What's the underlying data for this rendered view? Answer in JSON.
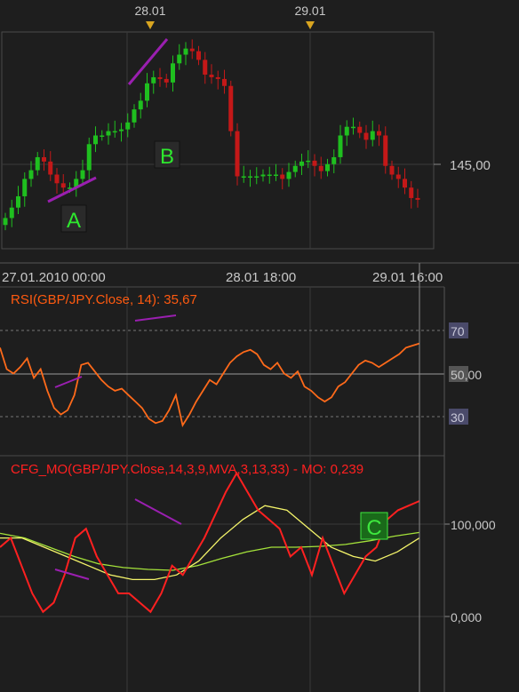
{
  "colors": {
    "background": "#1e1e1e",
    "grid": "#3a3a3a",
    "bull": "#1fbf1f",
    "bear": "#c41818",
    "rsi": "#ff6a1a",
    "mo": "#ff2020",
    "signal_yellow": "#f4f46a",
    "signal_green": "#a4e23a",
    "trendline": "#9a1fb0",
    "label_text": "#c8c8c8",
    "rsi_title": "#ff5a10",
    "mo_title": "#ff2020",
    "axis_tag_bg": "#4a4a6a",
    "marker": "#d9a520"
  },
  "top_axis": {
    "dates": [
      "28.01",
      "29.01"
    ]
  },
  "price_panel": {
    "price_label": "145,00",
    "markers": [
      "A",
      "B"
    ]
  },
  "time_axis": {
    "labels": [
      "27.01.2010 00:00",
      "28.01 18:00",
      "29.01 16:00"
    ]
  },
  "rsi_panel": {
    "title": "RSI(GBP/JPY.Close, 14): 35,67",
    "levels": [
      "70",
      "50,00",
      "30"
    ]
  },
  "mo_panel": {
    "title": "CFG_MO(GBP/JPY.Close,14,3,9,MVA,3,13,33) -  MO: 0,239",
    "levels": [
      "100,000",
      "0,000"
    ],
    "marker": "C"
  },
  "chart_data": [
    {
      "type": "candlestick",
      "title": "GBP/JPY",
      "x_labels": [
        "27.01.2010 00:00",
        "28.01 18:00",
        "29.01 16:00"
      ],
      "y_tick_labels": [
        "145,00"
      ],
      "series": [
        {
          "name": "GBP/JPY",
          "closes": [
            144.5,
            144.62,
            144.75,
            144.95,
            145.05,
            145.2,
            145.15,
            145.0,
            144.9,
            144.85,
            144.85,
            144.95,
            145.05,
            145.35,
            145.45,
            145.45,
            145.5,
            145.5,
            145.52,
            145.6,
            145.75,
            145.85,
            146.05,
            146.12,
            146.1,
            146.06,
            146.28,
            146.38,
            146.45,
            146.42,
            146.32,
            146.15,
            146.12,
            146.1,
            146.02,
            145.5,
            144.98,
            144.98,
            144.98,
            144.98,
            145.0,
            145.0,
            145.0,
            144.95,
            145.03,
            145.1,
            145.15,
            145.16,
            145.1,
            145.04,
            145.12,
            145.2,
            145.45,
            145.55,
            145.55,
            145.48,
            145.4,
            145.5,
            145.45,
            145.1,
            145.0,
            144.95,
            144.85,
            144.73,
            144.71
          ]
        }
      ],
      "annotations": [
        "A",
        "B"
      ]
    },
    {
      "type": "line",
      "title": "RSI(GBP/JPY.Close, 14): 35,67",
      "y_tick_labels": [
        "70",
        "50,00",
        "30"
      ],
      "ylim": [
        10,
        90
      ],
      "series": [
        {
          "name": "RSI(GBP/JPY.Close, 14)",
          "values": [
            38,
            48,
            50,
            47,
            43,
            52,
            48,
            58,
            66,
            69,
            67,
            60,
            46,
            45,
            49,
            53,
            56,
            58,
            57,
            60,
            63,
            66,
            71,
            73,
            72,
            67,
            60,
            74,
            69,
            63,
            58,
            53,
            55,
            50,
            45,
            42,
            40,
            39,
            41,
            46,
            48,
            45,
            50,
            52,
            49,
            56,
            58,
            61,
            63,
            61,
            56,
            54,
            50,
            46,
            44,
            45,
            47,
            45,
            43,
            41,
            38,
            37,
            36
          ]
        }
      ]
    },
    {
      "type": "line",
      "title": "CFG_MO(GBP/JPY.Close,14,3,9,MVA,3,13,33) -  MO: 0,239",
      "y_tick_labels": [
        "100,000",
        "0,000"
      ],
      "ylim": [
        -50,
        175
      ],
      "series": [
        {
          "name": "MO",
          "values": [
            50,
            40,
            70,
            100,
            120,
            110,
            80,
            40,
            30,
            60,
            80,
            100,
            100,
            110,
            120,
            100,
            70,
            80,
            60,
            40,
            15,
            -10,
            -30,
            -10,
            10,
            20,
            30,
            60,
            50,
            80,
            40,
            70,
            100,
            80,
            60,
            50,
            20,
            10,
            5,
            0
          ]
        },
        {
          "name": "yellow",
          "values": [
            40,
            40,
            50,
            60,
            70,
            80,
            85,
            85,
            80,
            65,
            40,
            20,
            5,
            10,
            30,
            50,
            60,
            65,
            55,
            40
          ]
        },
        {
          "name": "green",
          "values": [
            35,
            40,
            50,
            60,
            68,
            72,
            74,
            75,
            70,
            62,
            55,
            50,
            50,
            49,
            47,
            43,
            38,
            34
          ]
        }
      ],
      "annotations": [
        "C"
      ]
    }
  ]
}
